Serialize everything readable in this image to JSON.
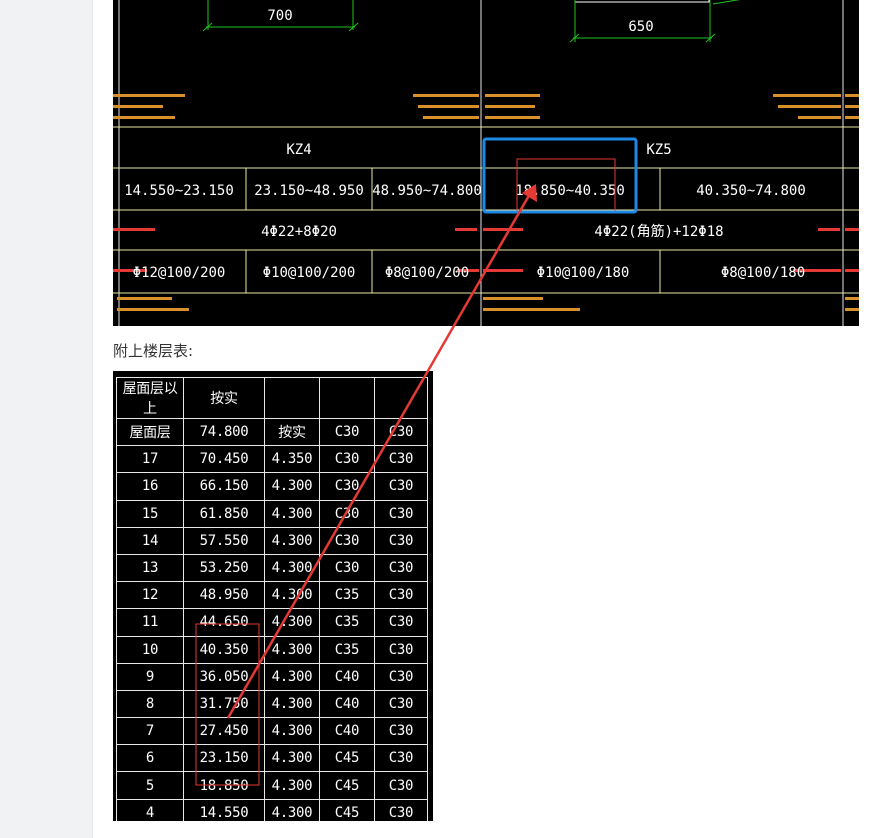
{
  "cad": {
    "dim_left": "700",
    "dim_right": "650",
    "col_kz4": "KZ4",
    "col_kz5": "KZ5",
    "range_1": "14.550~23.150",
    "range_2": "23.150~48.950",
    "range_3": "48.950~74.800",
    "range_4": "18.850~40.350",
    "range_5": "40.350~74.800",
    "rebar_kz4": "4Φ22+8Φ20",
    "rebar_kz5": "4Φ22(角筋)+12Φ18",
    "stirrup_1": "Φ12@100/200",
    "stirrup_2": "Φ10@100/200",
    "stirrup_3": "Φ8@100/200",
    "stirrup_4": "Φ10@100/180",
    "stirrup_5": "Φ8@100/180"
  },
  "caption": "附上楼层表:",
  "floor_table": {
    "header": [
      "屋面层以上",
      "按实",
      "",
      "",
      ""
    ],
    "rows": [
      [
        "屋面层",
        "74.800",
        "按实",
        "C30",
        "C30"
      ],
      [
        "17",
        "70.450",
        "4.350",
        "C30",
        "C30"
      ],
      [
        "16",
        "66.150",
        "4.300",
        "C30",
        "C30"
      ],
      [
        "15",
        "61.850",
        "4.300",
        "C30",
        "C30"
      ],
      [
        "14",
        "57.550",
        "4.300",
        "C30",
        "C30"
      ],
      [
        "13",
        "53.250",
        "4.300",
        "C30",
        "C30"
      ],
      [
        "12",
        "48.950",
        "4.300",
        "C35",
        "C30"
      ],
      [
        "11",
        "44.650",
        "4.300",
        "C35",
        "C30"
      ],
      [
        "10",
        "40.350",
        "4.300",
        "C35",
        "C30"
      ],
      [
        "9",
        "36.050",
        "4.300",
        "C40",
        "C30"
      ],
      [
        "8",
        "31.750",
        "4.300",
        "C40",
        "C30"
      ],
      [
        "7",
        "27.450",
        "4.300",
        "C40",
        "C30"
      ],
      [
        "6",
        "23.150",
        "4.300",
        "C45",
        "C30"
      ],
      [
        "5",
        "18.850",
        "4.300",
        "C45",
        "C30"
      ],
      [
        "4",
        "14.550",
        "4.300",
        "C45",
        "C30"
      ]
    ]
  },
  "colors": {
    "highlight_blue": "#1e88e5",
    "annotation_red": "#e53935",
    "cad_line": "#e8e8a0",
    "cad_green": "#21c521",
    "cad_orange": "#d9902a"
  }
}
